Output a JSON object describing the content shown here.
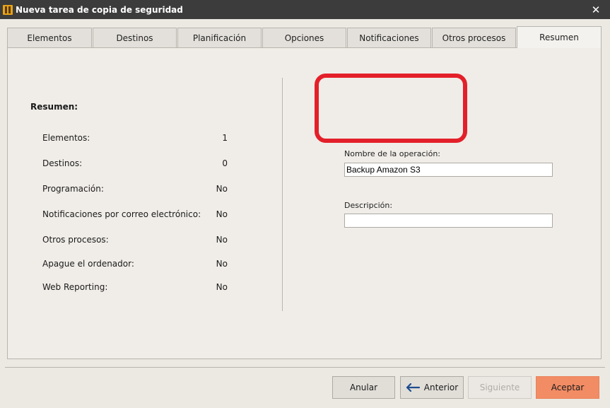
{
  "window": {
    "title": "Nueva tarea de copia de seguridad",
    "close_glyph": "✕"
  },
  "tabs": [
    {
      "label": "Elementos"
    },
    {
      "label": "Destinos"
    },
    {
      "label": "Planificación"
    },
    {
      "label": "Opciones"
    },
    {
      "label": "Notificaciones"
    },
    {
      "label": "Otros procesos"
    },
    {
      "label": "Resumen",
      "active": true
    }
  ],
  "summary": {
    "heading": "Resumen:",
    "rows": [
      {
        "label": "Elementos:",
        "value": "1"
      },
      {
        "label": "Destinos:",
        "value": "0"
      },
      {
        "label": "Programación:",
        "value": "No"
      },
      {
        "label": "Notificaciones por correo electrónico:",
        "value": "No"
      },
      {
        "label": "Otros procesos:",
        "value": "No"
      },
      {
        "label": "Apague el ordenador:",
        "value": "No"
      },
      {
        "label": "Web Reporting:",
        "value": "No"
      }
    ]
  },
  "form": {
    "name_label": "Nombre de la operación:",
    "name_value": "Backup Amazon S3",
    "description_label": "Descripción:",
    "description_value": ""
  },
  "buttons": {
    "cancel": "Anular",
    "back": "Anterior",
    "next": "Siguiente",
    "accept": "Aceptar"
  },
  "colors": {
    "titlebar": "#3c3c3c",
    "accent_button": "#f28c64",
    "highlight": "#e3202a"
  },
  "icons": {
    "app": "app-icon",
    "close": "close-icon",
    "back_arrow": "arrow-left-icon"
  }
}
